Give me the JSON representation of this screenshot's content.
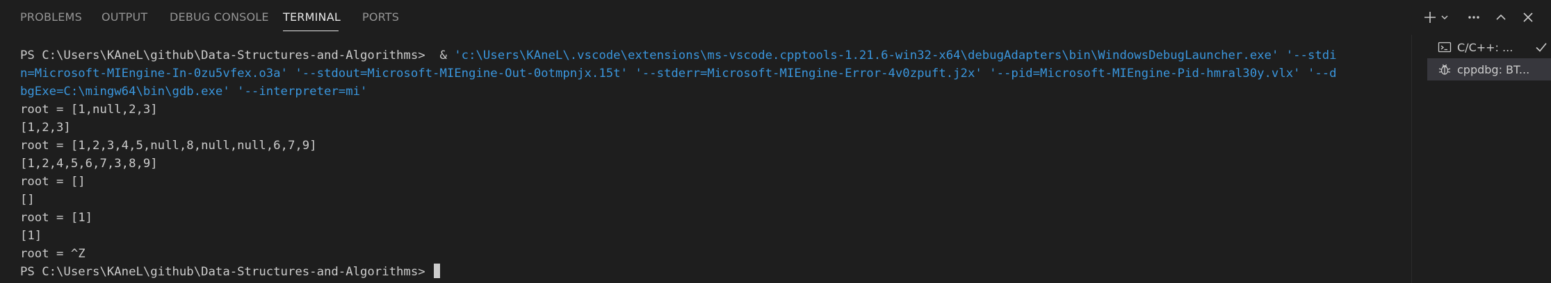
{
  "tabs": [
    {
      "label": "PROBLEMS"
    },
    {
      "label": "OUTPUT"
    },
    {
      "label": "DEBUG CONSOLE"
    },
    {
      "label": "TERMINAL"
    },
    {
      "label": "PORTS"
    }
  ],
  "active_tab": "TERMINAL",
  "toolbar": {
    "icons": [
      "plus-icon",
      "chevron-down-icon",
      "more-icon",
      "maximize-panel-icon",
      "close-icon"
    ]
  },
  "terminal": {
    "prompt_1": "PS C:\\Users\\KAneL\\github\\Data-Structures-and-Algorithms>  & ",
    "command_line_1": "'c:\\Users\\KAneL\\.vscode\\extensions\\ms-vscode.cpptools-1.21.6-win32-x64\\debugAdapters\\bin\\WindowsDebugLauncher.exe' '--stdi",
    "command_line_2": "n=Microsoft-MIEngine-In-0zu5vfex.o3a' '--stdout=Microsoft-MIEngine-Out-0otmpnjx.15t' '--stderr=Microsoft-MIEngine-Error-4v0zpuft.j2x' '--pid=Microsoft-MIEngine-Pid-hmral30y.vlx' '--d",
    "command_line_3": "bgExe=C:\\mingw64\\bin\\gdb.exe' '--interpreter=mi'",
    "output": [
      "root = [1,null,2,3]",
      "[1,2,3]",
      "root = [1,2,3,4,5,null,8,null,null,6,7,9]",
      "[1,2,4,5,6,7,3,8,9]",
      "root = []",
      "[]",
      "root = [1]",
      "[1]",
      "root = ^Z"
    ],
    "final_prompt": "PS C:\\Users\\KAneL\\github\\Data-Structures-and-Algorithms> "
  },
  "terminal_list": [
    {
      "label": "C/C++: ...",
      "icon": "terminal-icon",
      "status_icon": "check-icon"
    },
    {
      "label": "cppdbg: BT...",
      "icon": "bug-icon"
    }
  ],
  "colors": {
    "background": "#1e1e1e",
    "text": "#cccccc",
    "command": "#3a96dd",
    "tab_inactive": "#969696",
    "tab_active": "#e7e7e7",
    "selected_item": "#37373d"
  }
}
